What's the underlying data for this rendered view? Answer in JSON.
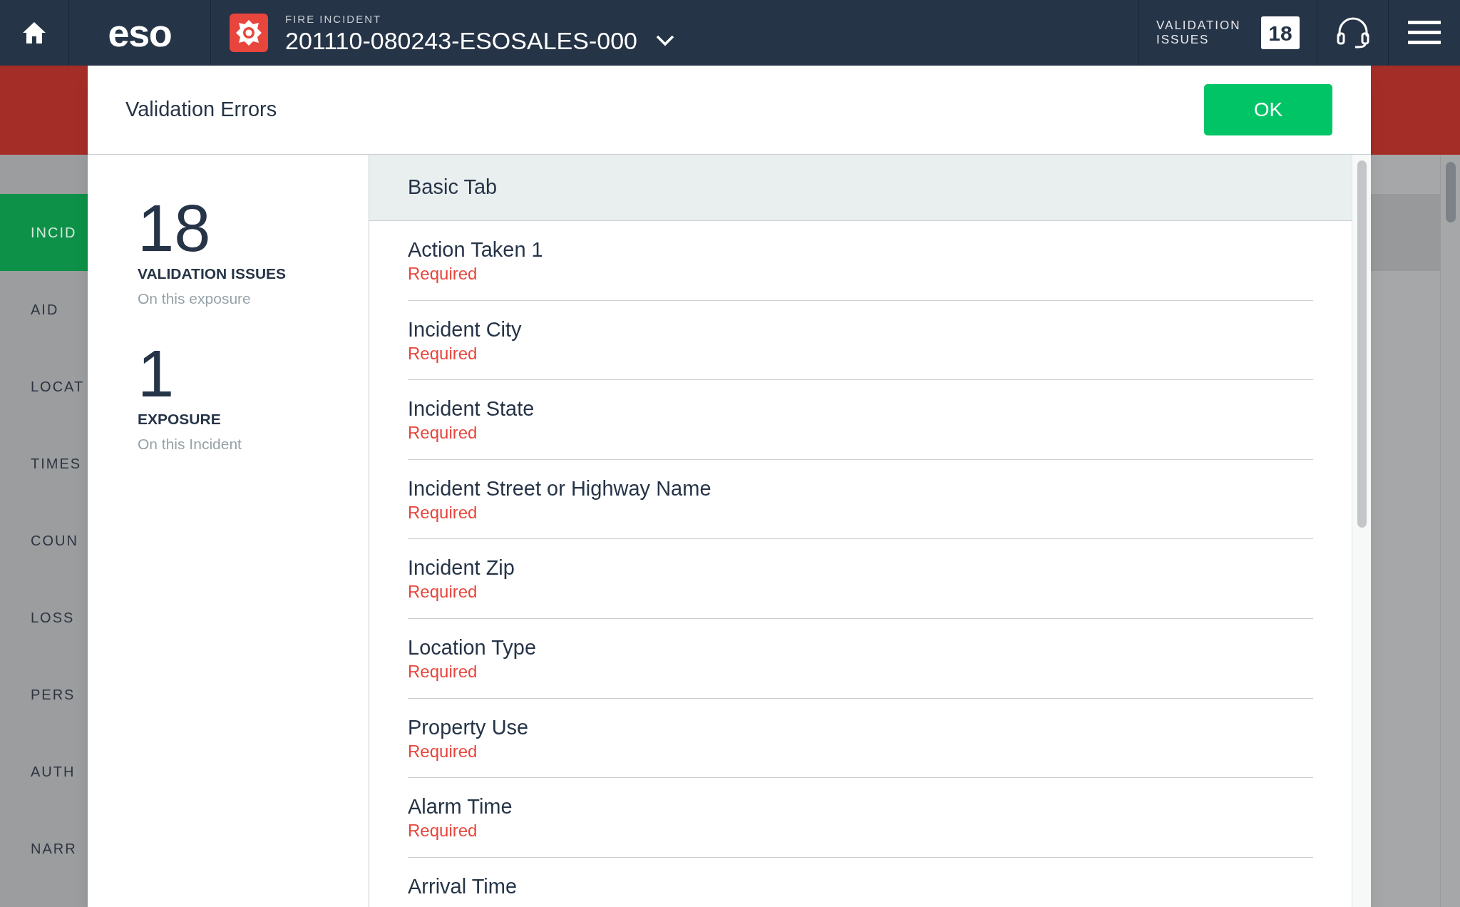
{
  "top_bar": {
    "logo": "eso",
    "record_type": "FIRE INCIDENT",
    "incident_number": "201110-080243-ESOSALES-000",
    "validation_label": "VALIDATION ISSUES",
    "validation_count": "18"
  },
  "background": {
    "sidebar": [
      {
        "label": "INCID",
        "selected": true
      },
      {
        "label": "AID",
        "selected": false
      },
      {
        "label": "LOCAT",
        "selected": false
      },
      {
        "label": "TIMES",
        "selected": false
      },
      {
        "label": "COUN",
        "selected": false
      },
      {
        "label": "LOSS",
        "selected": false
      },
      {
        "label": "PERS",
        "selected": false
      },
      {
        "label": "AUTH",
        "selected": false
      },
      {
        "label": "NARR",
        "selected": false
      }
    ]
  },
  "modal": {
    "title": "Validation Errors",
    "ok_button": "OK",
    "stats": [
      {
        "number": "18",
        "label": "VALIDATION ISSUES",
        "note": "On this exposure"
      },
      {
        "number": "1",
        "label": "EXPOSURE",
        "note": "On this Incident"
      }
    ],
    "section": "Basic Tab",
    "errors": [
      {
        "field": "Action Taken 1",
        "message": "Required"
      },
      {
        "field": "Incident City",
        "message": "Required"
      },
      {
        "field": "Incident State",
        "message": "Required"
      },
      {
        "field": "Incident Street or Highway Name",
        "message": "Required"
      },
      {
        "field": "Incident Zip",
        "message": "Required"
      },
      {
        "field": "Location Type",
        "message": "Required"
      },
      {
        "field": "Property Use",
        "message": "Required"
      },
      {
        "field": "Alarm Time",
        "message": "Required"
      },
      {
        "field": "Arrival Time"
      }
    ]
  }
}
